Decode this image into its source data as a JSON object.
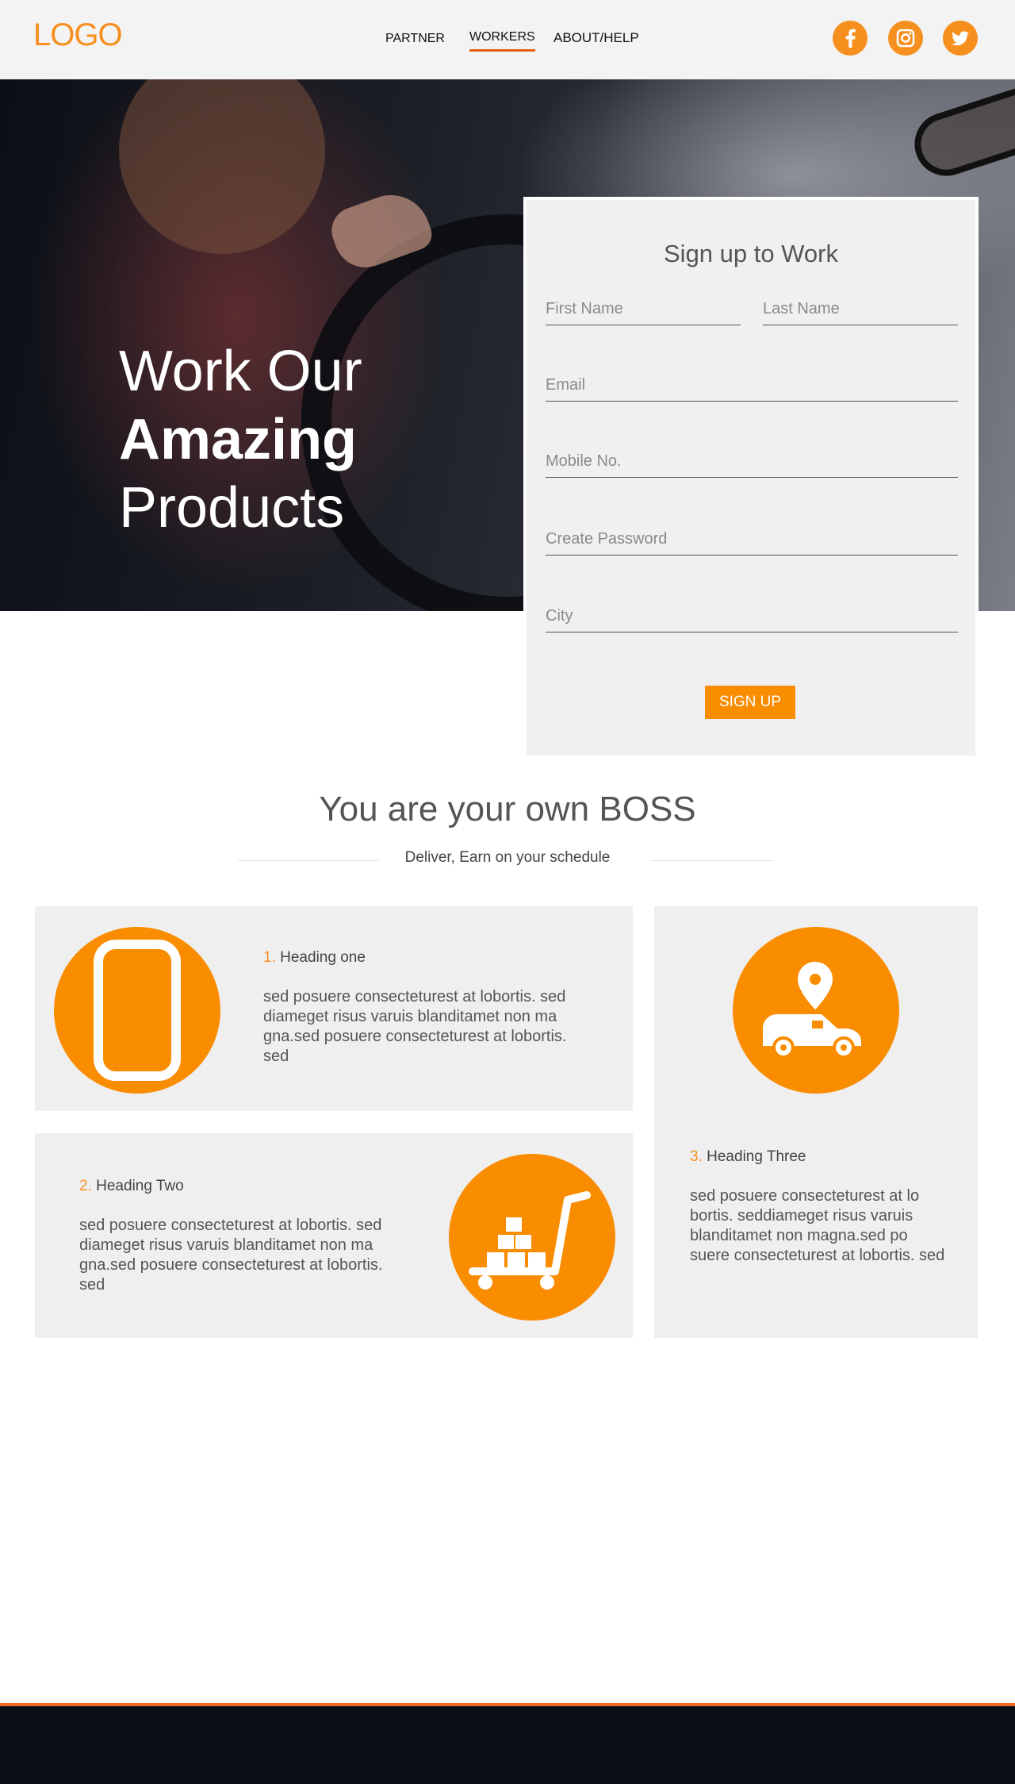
{
  "header": {
    "logo": "LOGO",
    "nav": [
      {
        "label": "PARTNER",
        "active": false
      },
      {
        "label": "WORKERS",
        "active": true
      },
      {
        "label": "ABOUT/HELP",
        "active": false
      }
    ],
    "social": [
      "facebook-icon",
      "instagram-icon",
      "twitter-icon"
    ]
  },
  "hero": {
    "line1": "Work Our",
    "line2": "Amazing",
    "line3": "Products"
  },
  "signup": {
    "title": "Sign up to Work",
    "first_name_placeholder": "First Name",
    "last_name_placeholder": "Last Name",
    "email_placeholder": "Email",
    "mobile_placeholder": "Mobile No.",
    "password_placeholder": "Create Password",
    "city_placeholder": "City",
    "button": "SIGN UP"
  },
  "boss": {
    "title": "You are your own BOSS",
    "subtitle": "Deliver, Earn on your schedule"
  },
  "cards": [
    {
      "num": "1.",
      "heading": "Heading one",
      "body": "sed posuere consecteturest at lobortis. sed diameget risus varuis blanditamet non ma gna.sed posuere consecteturest at lobortis. sed",
      "icon": "smartphone-icon"
    },
    {
      "num": "2.",
      "heading": "Heading Two",
      "body": "sed posuere consecteturest at lobortis. sed diameget risus varuis blanditamet non ma gna.sed posuere consecteturest at lobortis. sed",
      "icon": "hand-truck-icon"
    },
    {
      "num": "3.",
      "heading": "Heading Three",
      "body": "sed posuere consecteturest at lo bortis. seddiameget risus varuis blanditamet non magna.sed po suere consecteturest at lobortis. sed",
      "icon": "delivery-van-icon"
    }
  ],
  "colors": {
    "accent": "#fa8c00",
    "logo": "#f78f1e",
    "header_bg": "#f3f3f3",
    "card_bg": "#efefef",
    "footer_bg": "#0b0f17",
    "footer_border": "#f06b1e"
  }
}
